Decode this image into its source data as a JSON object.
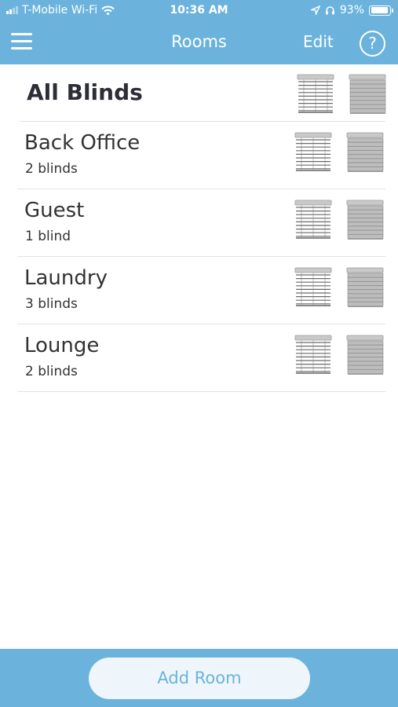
{
  "status_bar": {
    "carrier": "T-Mobile Wi-Fi",
    "time": "10:36 AM",
    "battery": "93%",
    "battery_level": 0.93,
    "icons": [
      "signal-icon",
      "wifi-icon",
      "location-icon",
      "headphones-icon",
      "battery-icon"
    ]
  },
  "nav": {
    "title": "Rooms",
    "edit_label": "Edit",
    "help_label": "?",
    "menu_icon": "hamburger-menu-icon"
  },
  "rooms": [
    {
      "name": "All Blinds",
      "count": ""
    },
    {
      "name": "Back Office",
      "count": "2 blinds"
    },
    {
      "name": "Guest",
      "count": "1 blind"
    },
    {
      "name": "Laundry",
      "count": "3 blinds"
    },
    {
      "name": "Lounge",
      "count": "2 blinds"
    }
  ],
  "row_icons": {
    "open": "blinds-open-icon",
    "closed": "blinds-closed-icon"
  },
  "footer": {
    "add_room_label": "Add Room"
  },
  "colors": {
    "accent": "#6bb3dd",
    "button_bg": "#eef6fb",
    "text": "#2f2f2f",
    "divider": "#e3e3e3"
  }
}
